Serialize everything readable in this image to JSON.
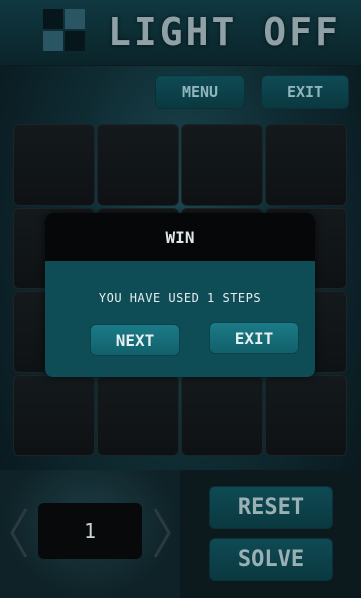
{
  "header": {
    "title": "LIGHT OFF"
  },
  "toolbar": {
    "menu_label": "MENU",
    "exit_label": "EXIT"
  },
  "board": {
    "rows": 4,
    "cols": 4,
    "lights_on": 0
  },
  "dialog": {
    "title": "WIN",
    "message": "YOU HAVE USED 1 STEPS",
    "next_label": "NEXT",
    "exit_label": "EXIT"
  },
  "level": {
    "value": "1"
  },
  "controls": {
    "reset_label": "RESET",
    "solve_label": "SOLVE"
  },
  "colors": {
    "accent": "#1b7b87",
    "background": "#0f2b32"
  }
}
